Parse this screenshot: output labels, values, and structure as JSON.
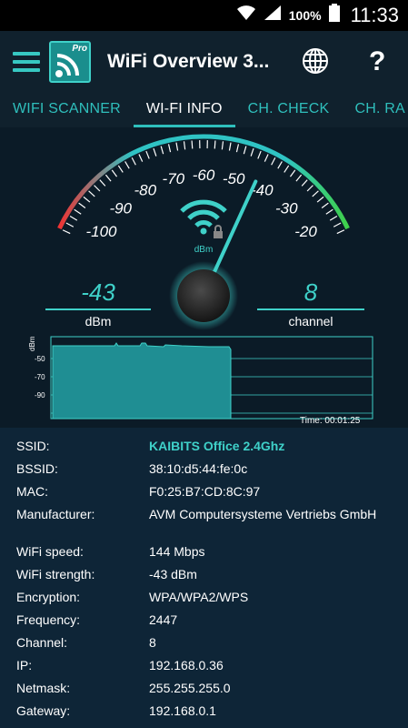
{
  "status": {
    "battery_pct": "100%",
    "time": "11:33"
  },
  "toolbar": {
    "title": "WiFi Overview 3...",
    "pro_badge": "Pro"
  },
  "tabs": [
    {
      "label": "WIFI SCANNER"
    },
    {
      "label": "WI-FI INFO"
    },
    {
      "label": "CH. CHECK"
    },
    {
      "label": "CH. RA"
    }
  ],
  "gauge": {
    "ticks": [
      "-100",
      "-90",
      "-80",
      "-70",
      "-60",
      "-50",
      "-40",
      "-30",
      "-20"
    ],
    "unit_label": "dBm",
    "signal_value": -43,
    "value_text": "-43",
    "value_unit": "dBm",
    "channel_text": "8",
    "channel_unit": "channel"
  },
  "graph": {
    "y_unit": "dBm",
    "y_ticks": [
      "-50",
      "-70",
      "-90"
    ],
    "time_label": "Time: 00:01:25"
  },
  "info": [
    {
      "key": "SSID:",
      "value": "KAIBITS Office 2.4Ghz"
    },
    {
      "key": "BSSID:",
      "value": "38:10:d5:44:fe:0c"
    },
    {
      "key": "MAC:",
      "value": "F0:25:B7:CD:8C:97"
    },
    {
      "key": "Manufacturer:",
      "value": "AVM Computersysteme Vertriebs GmbH"
    },
    {
      "key": "WiFi speed:",
      "value": "144 Mbps"
    },
    {
      "key": "WiFi strength:",
      "value": "-43 dBm"
    },
    {
      "key": "Encryption:",
      "value": "WPA/WPA2/WPS"
    },
    {
      "key": "Frequency:",
      "value": "2447"
    },
    {
      "key": "Channel:",
      "value": "8"
    },
    {
      "key": "IP:",
      "value": "192.168.0.36"
    },
    {
      "key": "Netmask:",
      "value": "255.255.255.0"
    },
    {
      "key": "Gateway:",
      "value": "192.168.0.1"
    }
  ],
  "colors": {
    "accent": "#3fd1c9",
    "bg": "#0b1b27"
  }
}
